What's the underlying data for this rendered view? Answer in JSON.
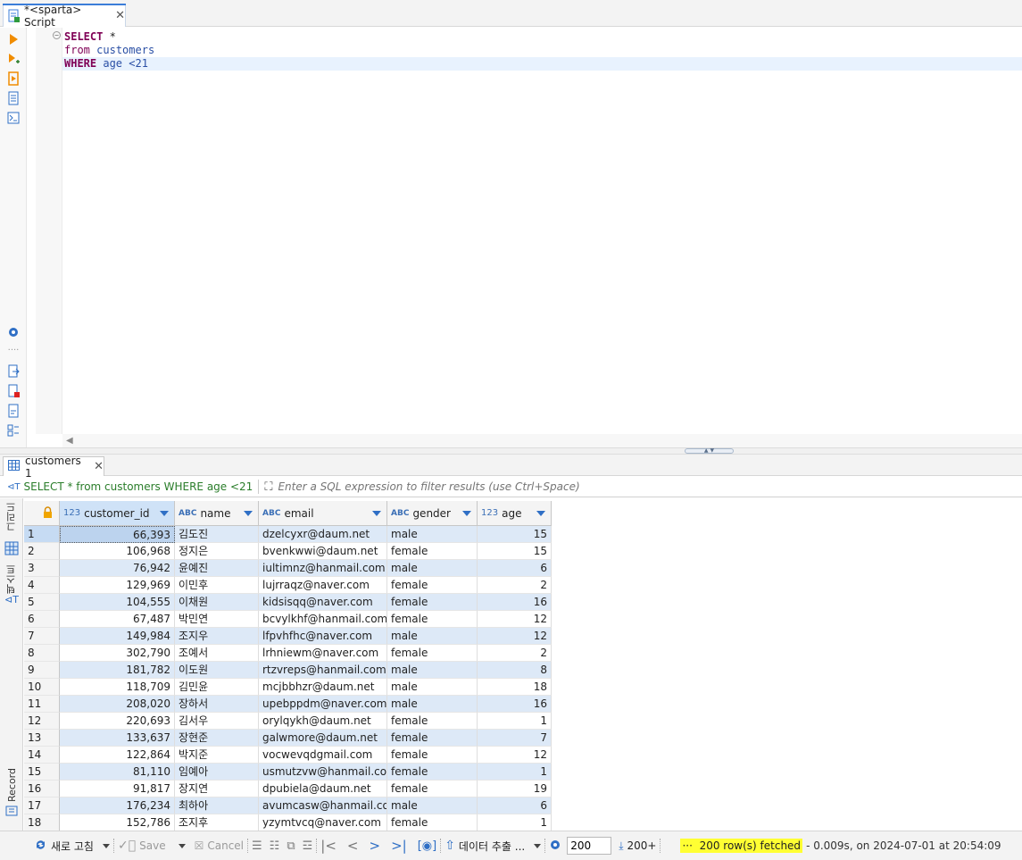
{
  "editor": {
    "tab_title": "*<sparta> Script",
    "code": {
      "line1_kw": "SELECT",
      "line1_rest": " *",
      "line2_kw": "from",
      "line2_table": "customers",
      "line3_kw": "WHERE",
      "line3_col": "age",
      "line3_rest": " <21"
    }
  },
  "results": {
    "tab_label": "customers 1",
    "filter_query": "SELECT * from customers WHERE age <21",
    "filter_placeholder": "Enter a SQL expression to filter results (use Ctrl+Space)",
    "side_tabs": {
      "grid": "그리드",
      "text": "텍스트",
      "record": "Record"
    },
    "columns": [
      {
        "type": "123",
        "name": "customer_id"
      },
      {
        "type": "ABC",
        "name": "name"
      },
      {
        "type": "ABC",
        "name": "email"
      },
      {
        "type": "ABC",
        "name": "gender"
      },
      {
        "type": "123",
        "name": "age"
      }
    ],
    "rows": [
      {
        "n": "1",
        "id": "66,393",
        "name": "김도진",
        "email": "dzelcyxr@daum.net",
        "gender": "male",
        "age": "15"
      },
      {
        "n": "2",
        "id": "106,968",
        "name": "정지은",
        "email": "bvenkwwi@daum.net",
        "gender": "female",
        "age": "15"
      },
      {
        "n": "3",
        "id": "76,942",
        "name": "윤예진",
        "email": "iultimnz@hanmail.com",
        "gender": "male",
        "age": "6"
      },
      {
        "n": "4",
        "id": "129,969",
        "name": "이민후",
        "email": "lujrraqz@naver.com",
        "gender": "female",
        "age": "2"
      },
      {
        "n": "5",
        "id": "104,555",
        "name": "이채원",
        "email": "kidsisqq@naver.com",
        "gender": "female",
        "age": "16"
      },
      {
        "n": "6",
        "id": "67,487",
        "name": "박민연",
        "email": "bcvylkhf@hanmail.com",
        "gender": "female",
        "age": "12"
      },
      {
        "n": "7",
        "id": "149,984",
        "name": "조지우",
        "email": "lfpvhfhc@naver.com",
        "gender": "male",
        "age": "12"
      },
      {
        "n": "8",
        "id": "302,790",
        "name": "조예서",
        "email": "lrhniewm@naver.com",
        "gender": "female",
        "age": "2"
      },
      {
        "n": "9",
        "id": "181,782",
        "name": "이도원",
        "email": "rtzvreps@hanmail.com",
        "gender": "male",
        "age": "8"
      },
      {
        "n": "10",
        "id": "118,709",
        "name": "김민윤",
        "email": "mcjbbhzr@daum.net",
        "gender": "male",
        "age": "18"
      },
      {
        "n": "11",
        "id": "208,020",
        "name": "장하서",
        "email": "upebppdm@naver.com",
        "gender": "male",
        "age": "16"
      },
      {
        "n": "12",
        "id": "220,693",
        "name": "김서우",
        "email": "orylqykh@daum.net",
        "gender": "female",
        "age": "1"
      },
      {
        "n": "13",
        "id": "133,637",
        "name": "장현준",
        "email": "galwmore@daum.net",
        "gender": "female",
        "age": "7"
      },
      {
        "n": "14",
        "id": "122,864",
        "name": "박지준",
        "email": "vocwevqdgmail.com",
        "gender": "female",
        "age": "12"
      },
      {
        "n": "15",
        "id": "81,110",
        "name": "임예아",
        "email": "usmutzvw@hanmail.com",
        "gender": "female",
        "age": "1"
      },
      {
        "n": "16",
        "id": "91,817",
        "name": "장지연",
        "email": "dpubiela@daum.net",
        "gender": "female",
        "age": "19"
      },
      {
        "n": "17",
        "id": "176,234",
        "name": "최하아",
        "email": "avumcasw@hanmail.com",
        "gender": "male",
        "age": "6"
      },
      {
        "n": "18",
        "id": "152,786",
        "name": "조지후",
        "email": "yzymtvcq@naver.com",
        "gender": "female",
        "age": "1"
      }
    ]
  },
  "toolbar": {
    "refresh": "새로 고침",
    "save": "Save",
    "cancel": "Cancel",
    "export": "데이터 추출 ...",
    "fetch_size": "200",
    "fetch_more": "200+",
    "status_highlight": "200 row(s) fetched",
    "status_rest": " - 0.009s, on 2024-07-01 at 20:54:09"
  },
  "colors": {
    "accent": "#3b7dd8",
    "keyword": "#7f0055",
    "identifier": "#2a4fa5",
    "row_alt": "#dde9f7",
    "status_highlight": "#ffff33",
    "filter_query": "#2a7d2a"
  }
}
